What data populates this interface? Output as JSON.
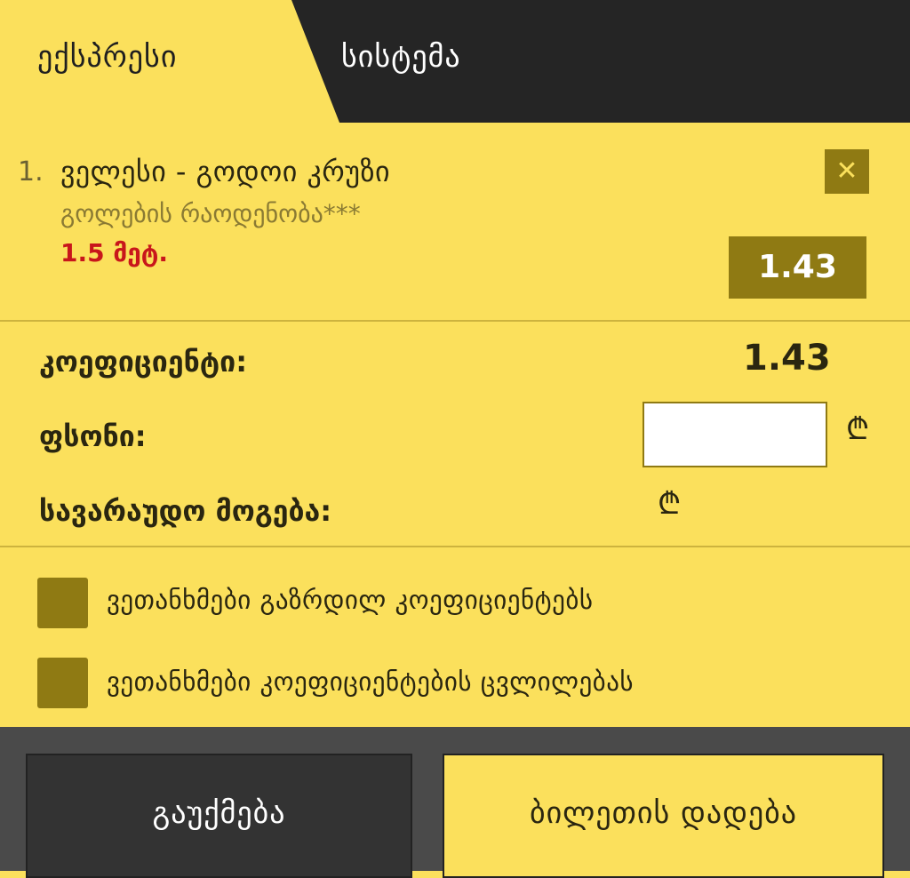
{
  "tabs": [
    {
      "label": "ექსპრესი",
      "active": true
    },
    {
      "label": "სისტემა",
      "active": false
    }
  ],
  "bet": {
    "index": "1.",
    "match": "ველესი - გოდოი კრუზი",
    "market": "გოლების რაოდენობა***",
    "selection": "1.5 მეტ.",
    "odds": "1.43",
    "remove_icon": "close-icon"
  },
  "summary": {
    "odds_label": "კოეფიციენტი:",
    "odds_value": "1.43",
    "stake_label": "ფსონი:",
    "stake_value": "",
    "possible_win_label": "სავარაუდო მოგება:",
    "currency_symbol": "₾"
  },
  "options": [
    {
      "label": "ვეთანხმები გაზრდილ კოეფიციენტებს",
      "checked": false
    },
    {
      "label": "ვეთანხმები კოეფიციენტების ცვლილებას",
      "checked": false
    }
  ],
  "actions": {
    "cancel_label": "გაუქმება",
    "place_label": "ბილეთის დადება"
  },
  "colors": {
    "accent_yellow": "#fbe05c",
    "dark_tab": "#252525",
    "olive": "#8f7a13",
    "selection_red": "#c8161b"
  }
}
